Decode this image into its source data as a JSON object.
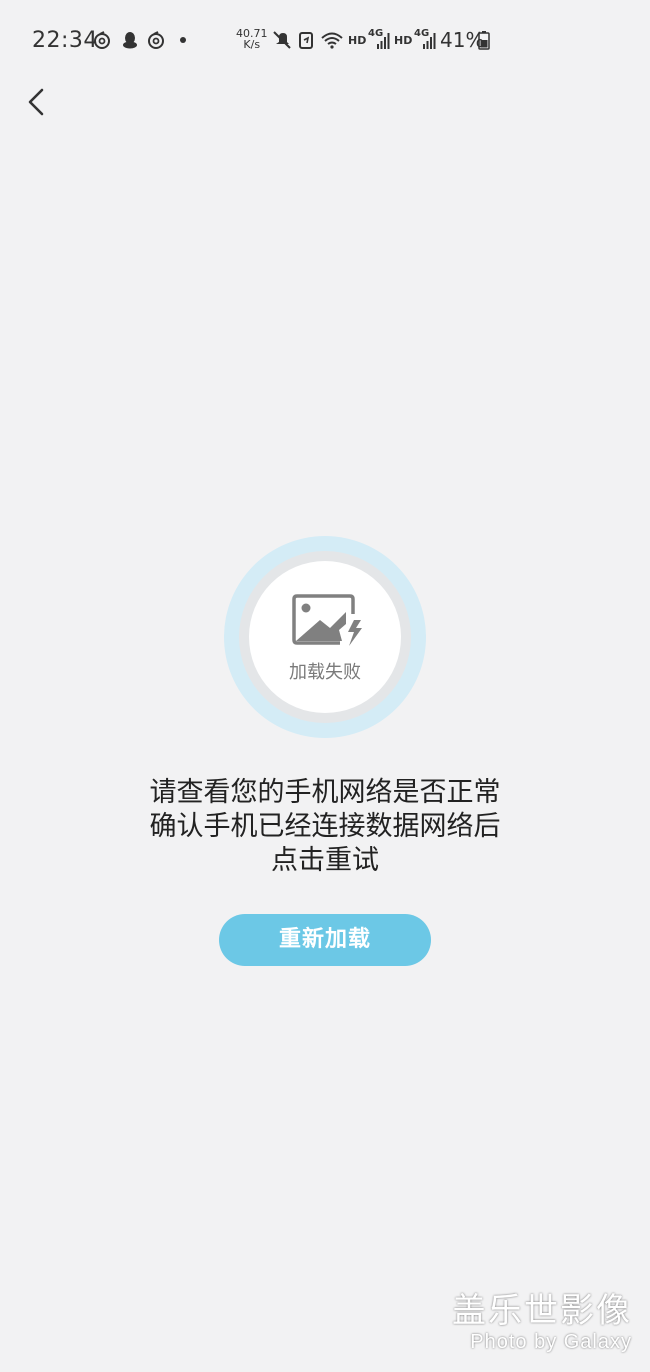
{
  "status_bar": {
    "time": "22:34",
    "net_speed_value": "40.71",
    "net_speed_unit": "K/s",
    "hd_label_1": "HD",
    "hd_label_2": "HD",
    "network_type_1": "4G",
    "network_type_2": "4G",
    "battery_percent": "41%",
    "icons": [
      "netease-music-icon",
      "qq-icon",
      "netease-music-icon",
      "dot-icon",
      "mute-icon",
      "battery-saver-icon",
      "wifi-icon",
      "signal-icon",
      "signal-icon",
      "battery-icon"
    ]
  },
  "nav": {
    "back_icon": "chevron-left-icon"
  },
  "error": {
    "graphic_label": "加载失败",
    "graphic_icon": "broken-image-icon",
    "message_lines": [
      "请查看您的手机网络是否正常",
      "确认手机已经连接数据网络后",
      "点击重试"
    ],
    "reload_label": "重新加载"
  },
  "watermark": {
    "title": "盖乐世影像",
    "subtitle": "Photo by Galaxy"
  },
  "colors": {
    "background": "#f2f2f3",
    "accent": "#6cc8e6",
    "ring": "#d4ecf6",
    "icon_gray": "#808080"
  }
}
